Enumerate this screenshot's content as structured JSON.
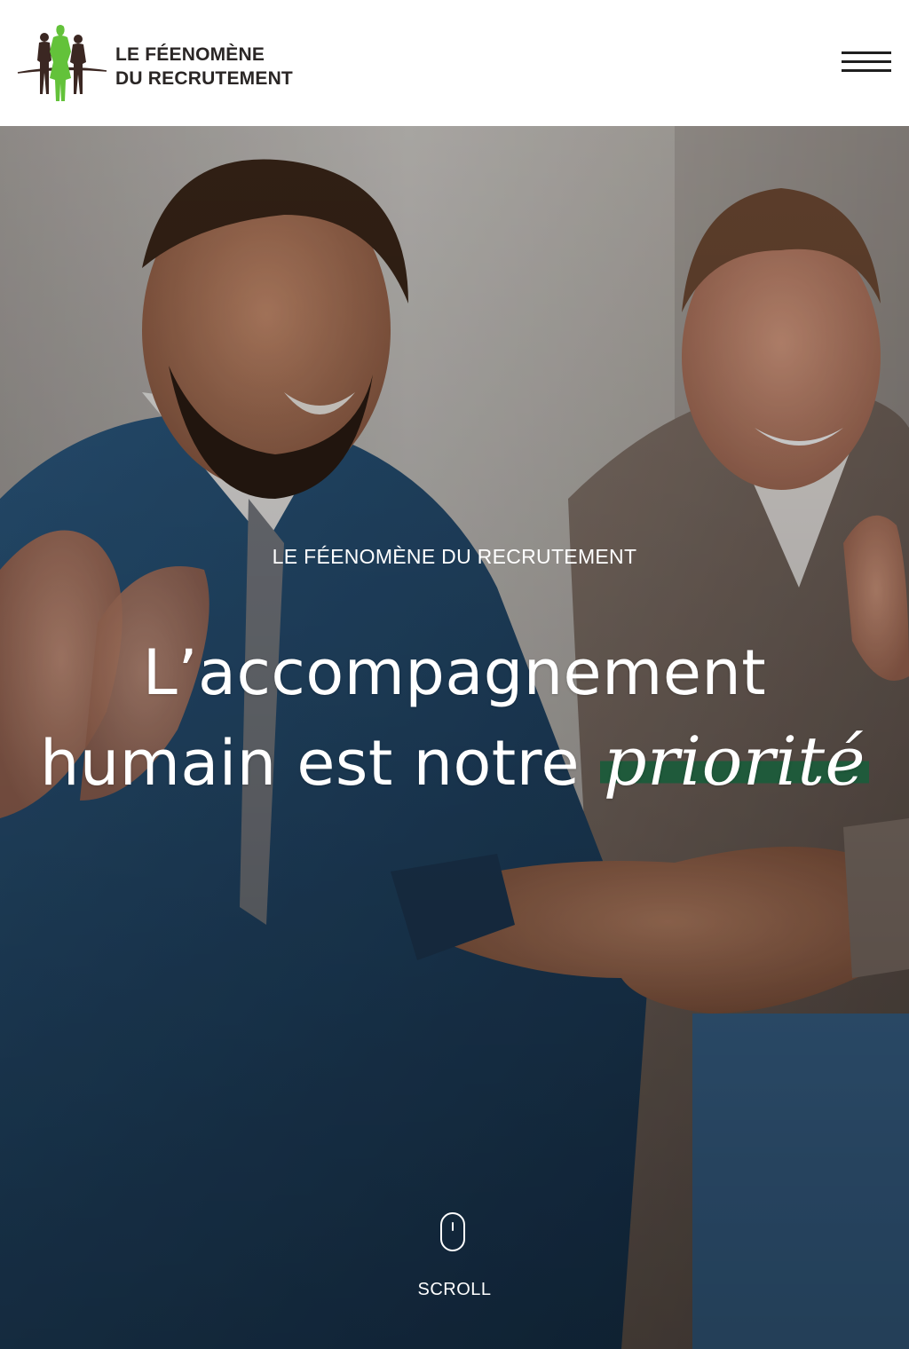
{
  "header": {
    "logo_line1": "LE FÉENOMÈNE",
    "logo_line2": "DU RECRUTEMENT",
    "menu_icon": "hamburger-menu-icon"
  },
  "hero": {
    "eyebrow": "LE FÉENOMÈNE DU RECRUTEMENT",
    "headline_line1": "L’accompagnement",
    "headline_line2": "humain est notre",
    "headline_accent": "priorité",
    "scroll_label": "SCROLL",
    "scroll_icon": "mouse-scroll-icon",
    "accent_color": "#1f5a3b"
  },
  "colors": {
    "logo_green": "#63c23a",
    "logo_brown": "#3b2722",
    "text_dark": "#2a2625"
  }
}
